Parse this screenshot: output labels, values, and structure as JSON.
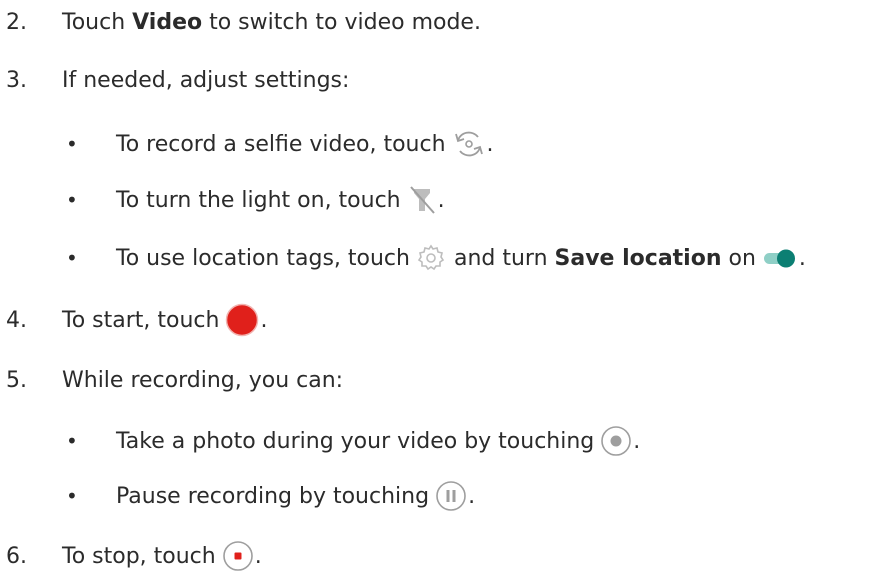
{
  "steps": [
    {
      "num": "2.",
      "pre": "Touch ",
      "bold": "Video",
      "post": " to switch to video mode."
    },
    {
      "num": "3.",
      "text": "If needed, adjust settings:"
    },
    {
      "num": "4.",
      "pre": "To start, touch",
      "post": "."
    },
    {
      "num": "5.",
      "text": "While recording, you can:"
    },
    {
      "num": "6.",
      "pre": "To stop, touch",
      "post": "."
    }
  ],
  "settings_bullets": [
    {
      "pre": "To record a selfie video, touch",
      "post": "."
    },
    {
      "pre": "To turn the light on, touch",
      "post": "."
    },
    {
      "pre": "To use location tags, touch",
      "mid": " and turn ",
      "bold": "Save location",
      "post_text": " on",
      "post": "."
    }
  ],
  "recording_bullets": [
    {
      "pre": "Take a photo during your video by touching",
      "post": "."
    },
    {
      "pre": "Pause recording by touching",
      "post": "."
    }
  ],
  "bullet_char": "•",
  "icons": {
    "switch_camera": "switch-camera-icon",
    "flash_off": "flash-off-icon",
    "settings": "settings-gear-icon",
    "toggle_on": "toggle-on-icon",
    "record": "record-icon",
    "capture": "capture-photo-icon",
    "pause": "pause-icon",
    "stop": "stop-icon"
  },
  "colors": {
    "text": "#2b2b2b",
    "record_red": "#e0201b",
    "toggle_teal": "#0c7f73",
    "icon_gray": "#9e9e9e"
  }
}
